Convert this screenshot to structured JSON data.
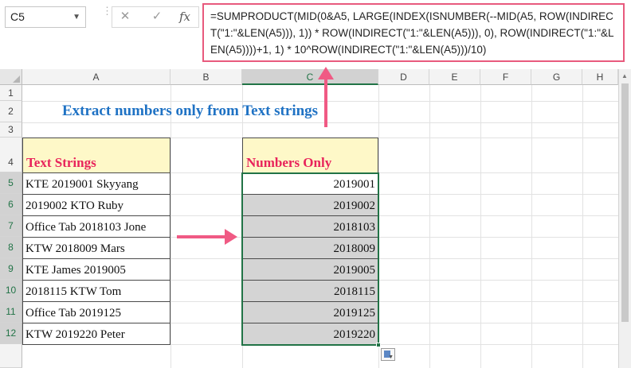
{
  "formula_bar": {
    "name_box": "C5",
    "cancel_glyph": "✕",
    "enter_glyph": "✓",
    "fx_label": "fx",
    "formula": "=SUMPRODUCT(MID(0&A5, LARGE(INDEX(ISNUMBER(--MID(A5, ROW(INDIRECT(\"1:\"&LEN(A5))), 1)) * ROW(INDIRECT(\"1:\"&LEN(A5))), 0), ROW(INDIRECT(\"1:\"&LEN(A5))))+1, 1) * 10^ROW(INDIRECT(\"1:\"&LEN(A5)))/10)"
  },
  "grid": {
    "columns": [
      "A",
      "B",
      "C",
      "D",
      "E",
      "F",
      "G",
      "H"
    ],
    "rows": [
      "1",
      "2",
      "3",
      "4",
      "5",
      "6",
      "7",
      "8",
      "9",
      "10",
      "11",
      "12"
    ],
    "selected_column": "C"
  },
  "sheet": {
    "title": "Extract numbers only from Text strings",
    "text_header": "Text Strings",
    "number_header": "Numbers Only",
    "text_strings": [
      "KTE 2019001 Skyyang",
      "2019002 KTO Ruby",
      "Office Tab 2018103 Jone",
      "KTW 2018009 Mars",
      "KTE James 2019005",
      "2018115 KTW Tom",
      "Office Tab 2019125",
      "KTW 2019220 Peter"
    ],
    "numbers_only": [
      "2019001",
      "2019002",
      "2018103",
      "2018009",
      "2019005",
      "2018115",
      "2019125",
      "2019220"
    ]
  },
  "icons": {
    "cancel": "close-icon",
    "enter": "check-icon",
    "fx": "function-icon",
    "paste_options": "paste-options-icon",
    "arrow_right": "arrow-right-icon",
    "arrow_up": "arrow-up-icon"
  },
  "colors": {
    "title": "#1f72c4",
    "header_text": "#e8235b",
    "header_fill": "#fef8c8",
    "selection": "#217346",
    "arrow": "#f05a84",
    "formula_border": "#e85a7d",
    "number_fill": "#d4d4d4"
  }
}
